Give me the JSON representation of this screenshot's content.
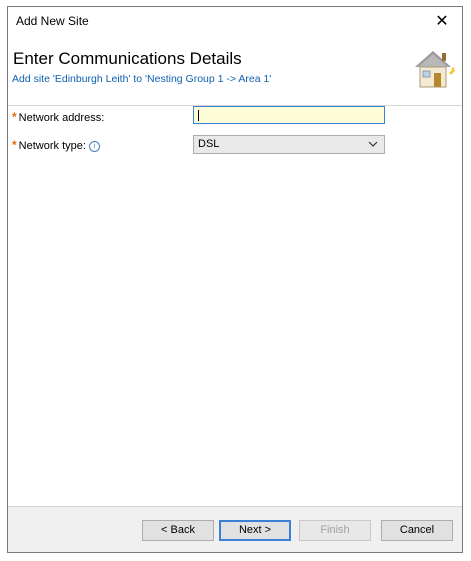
{
  "window": {
    "title": "Add New Site",
    "close_label": "✕"
  },
  "header": {
    "heading": "Enter Communications Details",
    "subheading": "Add site 'Edinburgh Leith' to 'Nesting Group 1 -> Area 1'"
  },
  "form": {
    "network_address": {
      "label": "Network address:",
      "value": "",
      "required_mark": "*"
    },
    "network_type": {
      "label": "Network type:",
      "selected": "DSL",
      "required_mark": "*",
      "info_symbol": "i"
    }
  },
  "buttons": {
    "back": "< Back",
    "next": "Next >",
    "finish": "Finish",
    "cancel": "Cancel"
  },
  "colors": {
    "accent": "#3c7fd6",
    "required": "#e06a10",
    "link": "#1060b0",
    "input_bg": "#fffcd8"
  },
  "icons": {
    "header_icon": "house-icon",
    "dropdown": "chevron-down-icon",
    "info": "info-icon"
  }
}
